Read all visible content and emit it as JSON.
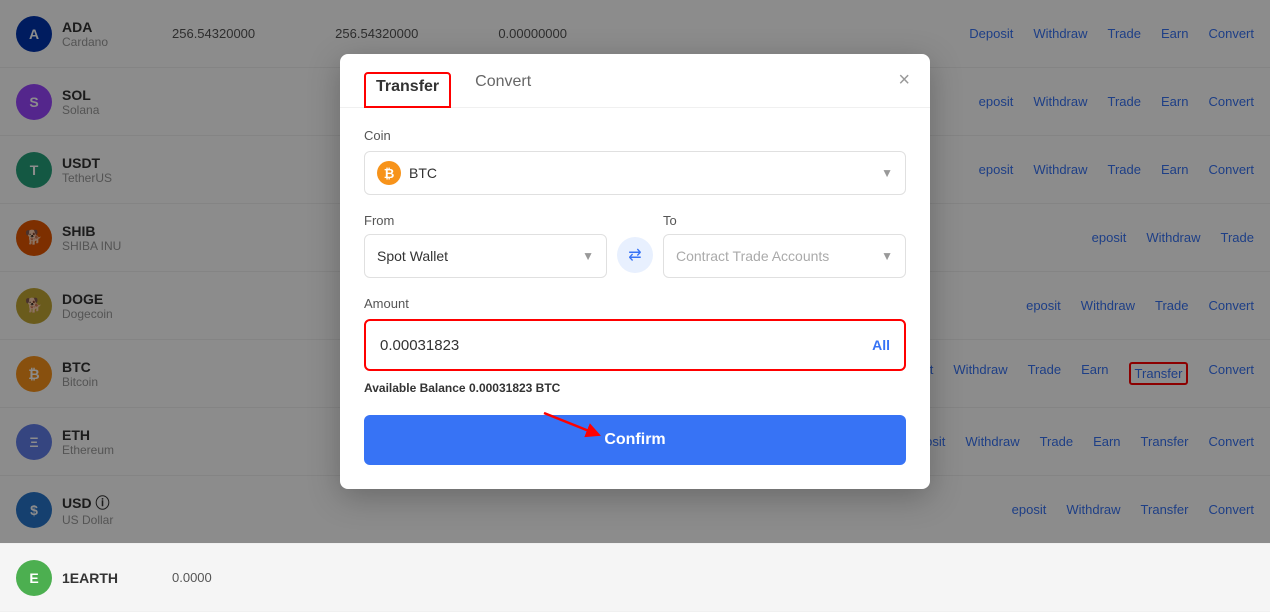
{
  "background": {
    "rows": [
      {
        "ticker": "ADA",
        "full": "Cardano",
        "color": "#0033ad",
        "symbol": "A",
        "balance1": "256.54320000",
        "balance2": "256.54320000",
        "balance3": "0.00000000",
        "actions": [
          "Deposit",
          "Withdraw",
          "Trade",
          "Earn",
          "Convert"
        ]
      },
      {
        "ticker": "SOL",
        "full": "Solana",
        "color": "#9945FF",
        "symbol": "S",
        "balance1": "",
        "balance2": "",
        "balance3": "",
        "actions": [
          "eposit",
          "Withdraw",
          "Trade",
          "Earn",
          "Convert"
        ]
      },
      {
        "ticker": "USDT",
        "full": "TetherUS",
        "color": "#26a17b",
        "symbol": "T",
        "balance1": "",
        "balance2": "",
        "balance3": "",
        "actions": [
          "eposit",
          "Withdraw",
          "Trade",
          "Earn",
          "Convert"
        ]
      },
      {
        "ticker": "SHIB",
        "full": "SHIBA INU",
        "color": "#e35700",
        "symbol": "S",
        "balance1": "",
        "balance2": "",
        "balance3": "",
        "actions": [
          "eposit",
          "Withdraw",
          "Trade"
        ]
      },
      {
        "ticker": "DOGE",
        "full": "Dogecoin",
        "color": "#c2a633",
        "symbol": "D",
        "balance1": "",
        "balance2": "",
        "balance3": "",
        "actions": [
          "eposit",
          "Withdraw",
          "Trade",
          "Convert"
        ]
      },
      {
        "ticker": "BTC",
        "full": "Bitcoin",
        "color": "#f7931a",
        "symbol": "₿",
        "balance1": "",
        "balance2": "",
        "balance3": "",
        "actions": [
          "eposit",
          "Withdraw",
          "Trade",
          "Earn",
          "Transfer",
          "Convert"
        ],
        "transferHighlighted": true
      },
      {
        "ticker": "ETH",
        "full": "Ethereum",
        "color": "#627eea",
        "symbol": "Ξ",
        "balance1": "",
        "balance2": "",
        "balance3": "",
        "actions": [
          "eposit",
          "Withdraw",
          "Trade",
          "Earn",
          "Transfer",
          "Convert"
        ]
      },
      {
        "ticker": "USD",
        "full": "US Dollar",
        "color": "#2775ca",
        "symbol": "$",
        "balance1": "",
        "balance2": "",
        "balance3": "",
        "actions": [
          "eposit",
          "Withdraw",
          "Transfer",
          "Convert"
        ]
      },
      {
        "ticker": "1EARTH",
        "full": "",
        "color": "#4caf50",
        "symbol": "E",
        "balance1": "0.0000",
        "balance2": "",
        "balance3": "",
        "actions": []
      }
    ]
  },
  "modal": {
    "tabs": [
      {
        "label": "Transfer",
        "active": true
      },
      {
        "label": "Convert",
        "active": false
      }
    ],
    "close_label": "×",
    "coin_label": "Coin",
    "coin_value": "BTC",
    "from_label": "From",
    "from_value": "Spot Wallet",
    "swap_label": "⇄",
    "to_label": "To",
    "to_placeholder": "Contract Trade Accounts",
    "amount_label": "Amount",
    "amount_value": "0.00031823",
    "all_label": "All",
    "available_label": "Available Balance",
    "available_amount": "0.00031823 BTC",
    "confirm_label": "Confirm"
  }
}
